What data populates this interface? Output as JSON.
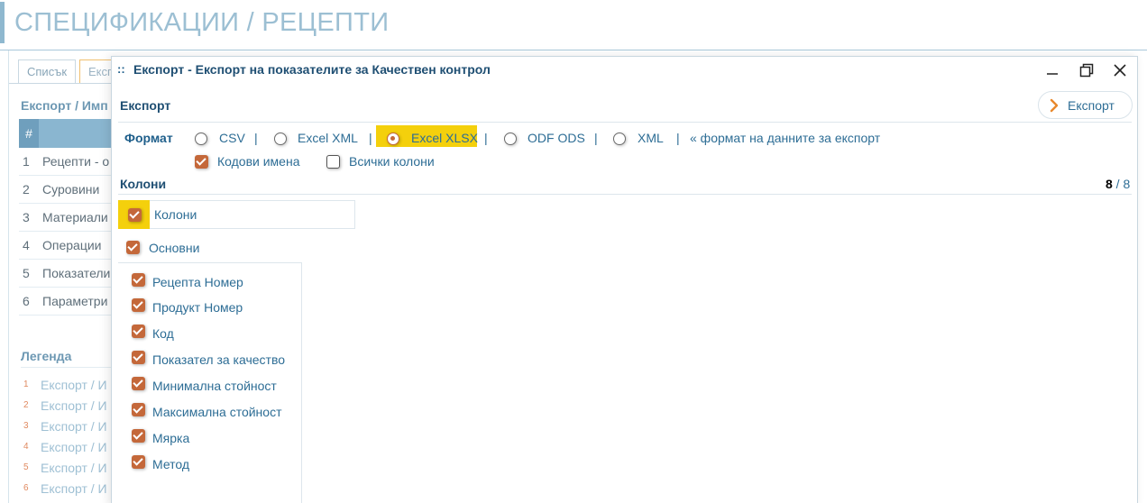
{
  "page": {
    "title": "СПЕЦИФИКАЦИИ / РЕЦЕПТИ",
    "tabs": [
      "Списък",
      "Експ"
    ],
    "section_title": "Експорт / Имп",
    "table_header_hash": "#",
    "rows": [
      {
        "n": "1",
        "label": "Рецепти - о"
      },
      {
        "n": "2",
        "label": "Суровини"
      },
      {
        "n": "3",
        "label": "Материали"
      },
      {
        "n": "4",
        "label": "Операции"
      },
      {
        "n": "5",
        "label": "Показатели"
      },
      {
        "n": "6",
        "label": "Параметри"
      }
    ],
    "legend_title": "Легенда",
    "legend": [
      {
        "n": "1",
        "label": "Експорт / И"
      },
      {
        "n": "2",
        "label": "Експорт / И"
      },
      {
        "n": "3",
        "label": "Експорт / И"
      },
      {
        "n": "4",
        "label": "Експорт / И"
      },
      {
        "n": "5",
        "label": "Експорт / И"
      },
      {
        "n": "6",
        "label": "Експорт / И"
      }
    ]
  },
  "dialog": {
    "grip": "::",
    "title": "Експорт - Експорт на показателите за Качествен контрол",
    "toolbar_title": "Експорт",
    "export_button": "Експорт",
    "format_label": "Формат",
    "formats": [
      {
        "label": "CSV",
        "checked": false
      },
      {
        "label": "Excel XML",
        "checked": false
      },
      {
        "label": "Excel XLSX",
        "checked": true
      },
      {
        "label": "ODF ODS",
        "checked": false
      },
      {
        "label": "XML",
        "checked": false
      }
    ],
    "separator": "|",
    "format_hint": "« формат на данните за експорт",
    "code_names": {
      "label": "Кодови имена",
      "checked": true
    },
    "all_columns": {
      "label": "Всички колони",
      "checked": false
    },
    "columns_title": "Колони",
    "columns_selected": "8",
    "columns_total_sep": " / ",
    "columns_total": "8",
    "columns_toggle": {
      "label": "Колони",
      "checked": true
    },
    "group": {
      "label": "Основни",
      "checked": true
    },
    "columns": [
      {
        "label": "Рецепта Номер",
        "checked": true
      },
      {
        "label": "Продукт Номер",
        "checked": true
      },
      {
        "label": "Код",
        "checked": true
      },
      {
        "label": "Показател за качество",
        "checked": true
      },
      {
        "label": "Минимална стойност",
        "checked": true
      },
      {
        "label": "Максимална стойност",
        "checked": true
      },
      {
        "label": "Мярка",
        "checked": true
      },
      {
        "label": "Метод",
        "checked": true
      }
    ]
  },
  "colors": {
    "accent": "#c4683a",
    "highlight": "#f4d00c",
    "link": "#2d6d95"
  }
}
